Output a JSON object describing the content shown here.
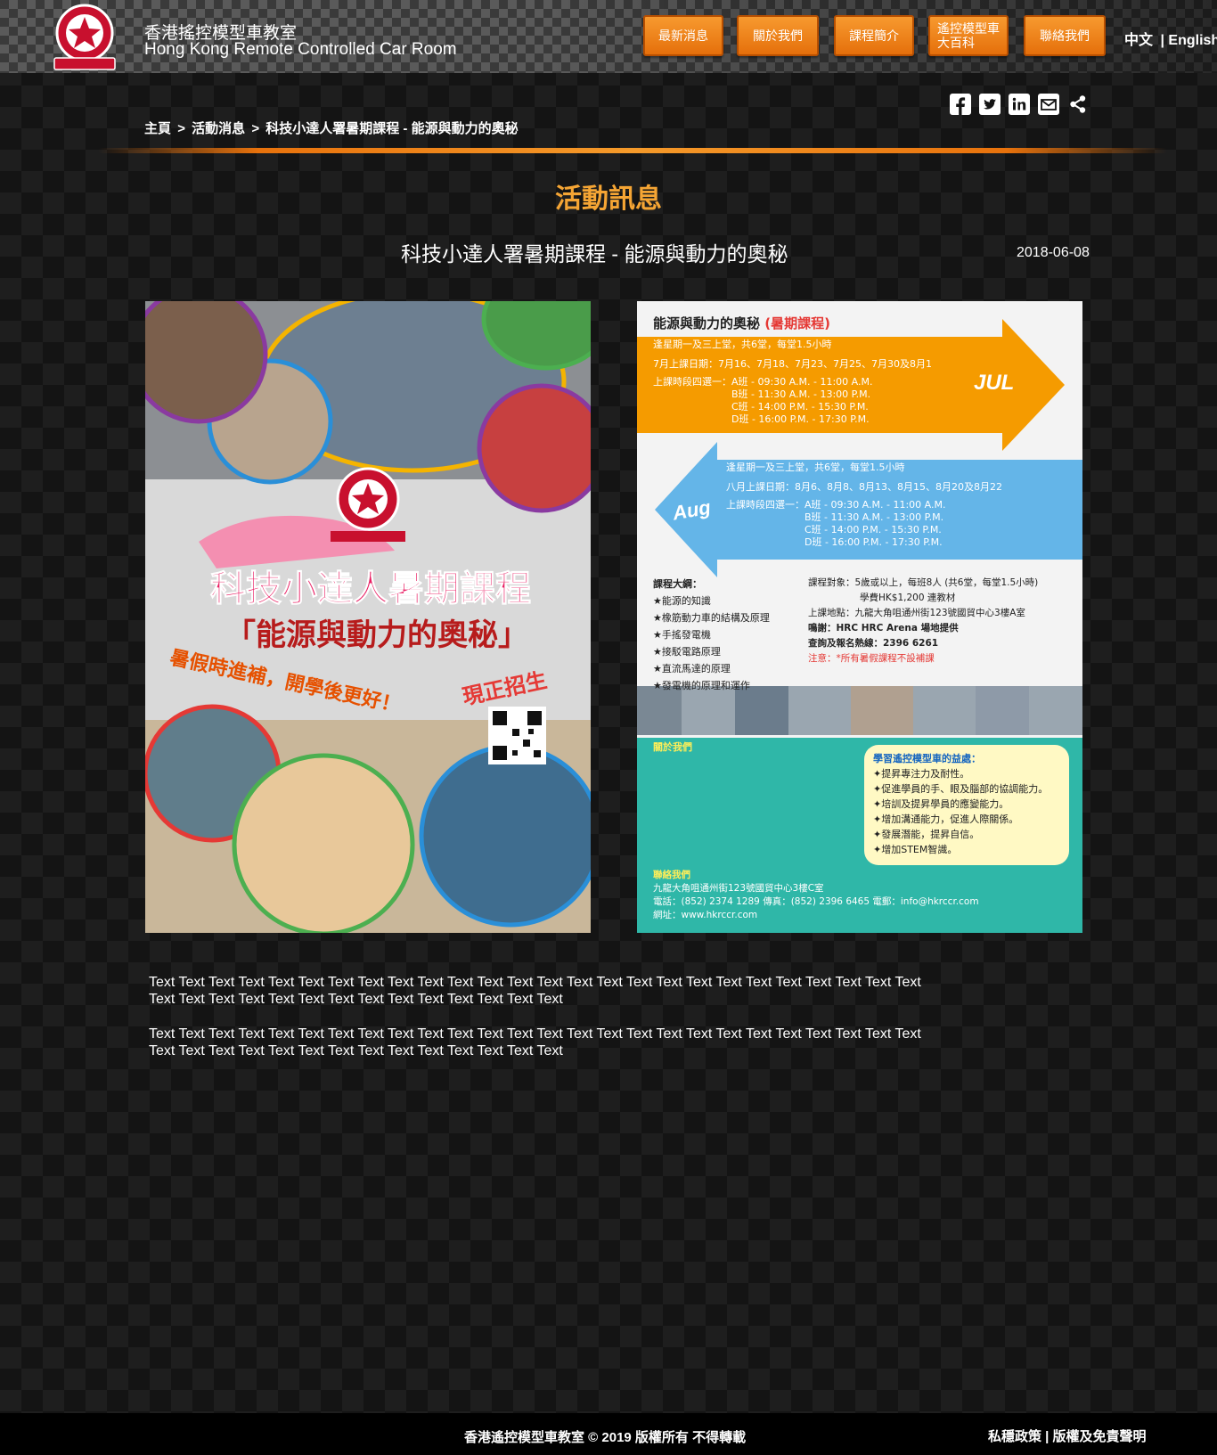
{
  "header": {
    "brand_zh": "香港搖控模型車教室",
    "brand_en": "Hong Kong Remote Controlled Car Room",
    "logo_text": "香港遙控模型車教室",
    "nav": {
      "news": "最新消息",
      "about": "關於我們",
      "courses": "課程簡介",
      "encyclopedia_line1": "遙控模型車",
      "encyclopedia_line2": "大百科",
      "contact": "聯絡我們"
    },
    "lang": {
      "zh": "中文",
      "sep": "|",
      "en": "English"
    }
  },
  "share_icons": [
    "facebook-icon",
    "twitter-icon",
    "linkedin-icon",
    "email-icon",
    "share-icon"
  ],
  "breadcrumb": {
    "home": "主頁",
    "sep": ">",
    "section": "活動消息",
    "current": "科技小達人署暑期課程 - 能源與動力的奧秘"
  },
  "section_title": "活動訊息",
  "article": {
    "title": "科技小達人署暑期課程 - 能源與動力的奧秘",
    "date": "2018-06-08",
    "paragraphs": [
      "Text Text Text Text Text Text Text Text Text Text Text Text Text Text Text Text Text Text Text Text Text Text Text Text Text Text Text Text Text Text Text Text Text Text Text Text Text Text Text Text",
      "Text Text Text Text Text Text Text Text Text Text Text Text Text Text Text Text Text Text Text Text Text Text Text Text Text Text Text Text Text Text Text Text Text Text Text Text Text Text Text Text"
    ]
  },
  "poster_left": {
    "headline": "科技小達人暑期課程",
    "subtitle": "「能源與動力的奧秘」",
    "slogan": "暑假時進補，開學後更好！",
    "enrol": "現正招生"
  },
  "poster_right": {
    "title": "能源與動力的奧秘",
    "title_tag": "(暑期課程)",
    "jul": {
      "schedule": "逢星期一及三上堂，共6堂，每堂1.5小時",
      "dates": "7月上課日期：7月16、7月18、7月23、7月25、7月30及8月1",
      "label": "上課時段四選一：",
      "slots": [
        "A班 - 09:30 A.M. - 11:00 A.M.",
        "B班 - 11:30 A.M. - 13:00 P.M.",
        "C班 - 14:00 P.M. - 15:30 P.M.",
        "D班 - 16:00 P.M. - 17:30 P.M."
      ],
      "tag": "JUL"
    },
    "aug": {
      "schedule": "逢星期一及三上堂，共6堂，每堂1.5小時",
      "dates": "八月上課日期：8月6、8月8、8月13、8月15、8月20及8月22",
      "label": "上課時段四選一：",
      "slots": [
        "A班 - 09:30 A.M. - 11:00 A.M.",
        "B班 - 11:30 A.M. - 13:00 P.M.",
        "C班 - 14:00 P.M. - 15:30 P.M.",
        "D班 - 16:00 P.M. - 17:30 P.M."
      ],
      "tag": "Aug"
    },
    "outline_title": "課程大綱：",
    "outline": [
      "★能源的知識",
      "★橡筋動力車的結構及原理",
      "★手搖發電機",
      "★接駁電路原理",
      "★直流馬達的原理",
      "★發電機的原理和運作"
    ],
    "target": "課程對象：5歲或以上，每班8人 (共6堂，每堂1.5小時)",
    "fee": "學費HK$1,200 連教材",
    "venue": "上課地點：九龍大角咀通州街123號國貿中心3樓A室",
    "thanks": "鳴謝：HRC HRC Arena 場地提供",
    "hotline": "查詢及報名熱線：2396 6261",
    "notice": "注意：*所有暑假課程不設補課",
    "about_title": "關於我們",
    "benefits_title": "學習遙控模型車的益處：",
    "benefits": [
      "✦提昇專注力及耐性。",
      "✦促進學員的手、眼及腦部的協調能力。",
      "✦培訓及提昇學員的應變能力。",
      "✦增加溝通能力，促進人際關係。",
      "✦發展潛能，提昇自信。",
      "✦增加STEM智識。"
    ],
    "contact_title": "聯絡我們",
    "address": "九龍大角咀通州街123號國貿中心3樓C室",
    "phone": "電話：(852) 2374 1289   傳真：(852) 2396 6465   電郵：info@hkrccr.com",
    "web": "網址：www.hkrccr.com"
  },
  "footer": {
    "copyright": "香港遙控模型車教室 © 2019 版權所有 不得轉載",
    "legal": "私穩政策 | 版權及免責聲明"
  }
}
